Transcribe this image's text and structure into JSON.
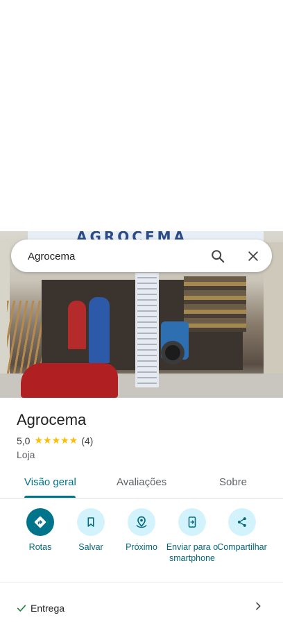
{
  "search": {
    "value": "Agrocema",
    "search_icon": "search-icon",
    "clear_icon": "close-icon"
  },
  "photo": {
    "sign_text": "AGROCEMA"
  },
  "place": {
    "name": "Agrocema",
    "rating": "5,0",
    "stars": "★★★★★",
    "review_count": "(4)",
    "category": "Loja"
  },
  "tabs": [
    {
      "label": "Visão geral",
      "active": true
    },
    {
      "label": "Avaliações",
      "active": false
    },
    {
      "label": "Sobre",
      "active": false
    }
  ],
  "actions": [
    {
      "label": "Rotas",
      "icon": "directions-icon"
    },
    {
      "label": "Salvar",
      "icon": "bookmark-icon"
    },
    {
      "label": "Próximo",
      "icon": "nearby-icon"
    },
    {
      "label": "Enviar para o smartphone",
      "icon": "send-to-phone-icon"
    },
    {
      "label": "Compartilhar",
      "icon": "share-icon"
    }
  ],
  "delivery": {
    "label": "Entrega",
    "check_icon": "check-icon",
    "chevron_icon": "chevron-right-icon"
  },
  "colors": {
    "accent": "#00748a",
    "action_bg": "#d2f3fb",
    "star": "#fbbc04"
  }
}
